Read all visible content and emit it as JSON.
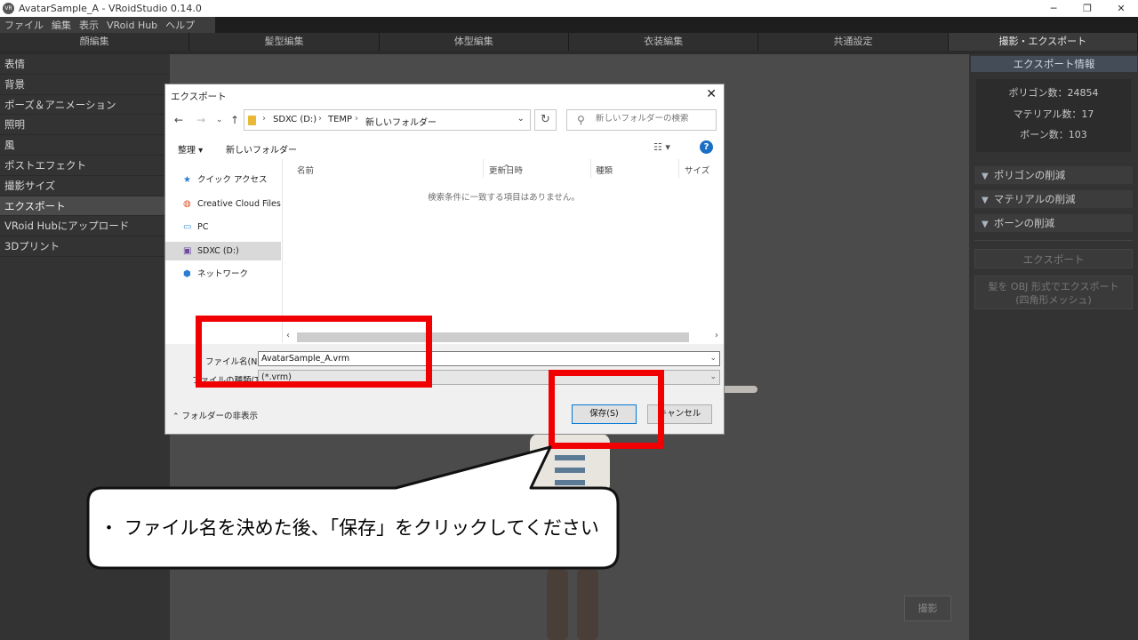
{
  "window": {
    "title": "AvatarSample_A - VRoidStudio 0.14.0",
    "controls": [
      "─",
      "❐",
      "✕"
    ]
  },
  "menu": [
    "ファイル",
    "編集",
    "表示",
    "VRoid Hub",
    "ヘルプ"
  ],
  "tabs": [
    "顔編集",
    "髪型編集",
    "体型編集",
    "衣装編集",
    "共通設定",
    "撮影・エクスポート"
  ],
  "sidebar": {
    "items": [
      "表情",
      "背景",
      "ポーズ＆アニメーション",
      "照明",
      "風",
      "ポストエフェクト",
      "撮影サイズ",
      "エクスポート",
      "VRoid Hubにアップロード",
      "3Dプリント"
    ],
    "active_index": 7
  },
  "right_panel": {
    "header": "エクスポート情報",
    "info": [
      "ポリゴン数：24854",
      "マテリアル数：17",
      "ボーン数：103"
    ],
    "sections": [
      "ポリゴンの削減",
      "マテリアルの削減",
      "ボーンの削減"
    ],
    "export_button": "エクスポート",
    "obj_button_line1": "髪を OBJ 形式でエクスポート",
    "obj_button_line2": "(四角形メッシュ)",
    "shoot_button": "撮影"
  },
  "dialog": {
    "title": "エクスポート",
    "address": [
      "SDXC (D:)",
      "TEMP",
      "新しいフォルダー"
    ],
    "search_placeholder": "新しいフォルダーの検索",
    "organize": "整理 ▾",
    "new_folder": "新しいフォルダー",
    "nav": [
      {
        "icon": "★",
        "label": "クイック アクセス"
      },
      {
        "icon": "◍",
        "label": "Creative Cloud Files"
      },
      {
        "icon": "▭",
        "label": "PC"
      },
      {
        "icon": "▣",
        "label": "SDXC (D:)"
      },
      {
        "icon": "⬢",
        "label": "ネットワーク"
      }
    ],
    "columns": [
      "名前",
      "更新日時",
      "種類",
      "サイズ"
    ],
    "empty_message": "検索条件に一致する項目はありません。",
    "filename_label": "ファイル名(N):",
    "filename_value": "AvatarSample_A.vrm",
    "filetype_label": "ファイルの種類(T):",
    "filetype_value": "(*.vrm)",
    "hide_folders": "フォルダーの非表示",
    "save": "保存(S)",
    "cancel": "キャンセル"
  },
  "callout": {
    "text": "・ ファイル名を決めた後、「保存」をクリックしてください"
  },
  "colors": {
    "highlight_red": "#f00000",
    "help_blue": "#1a6fc5",
    "save_border": "#0078d7"
  }
}
